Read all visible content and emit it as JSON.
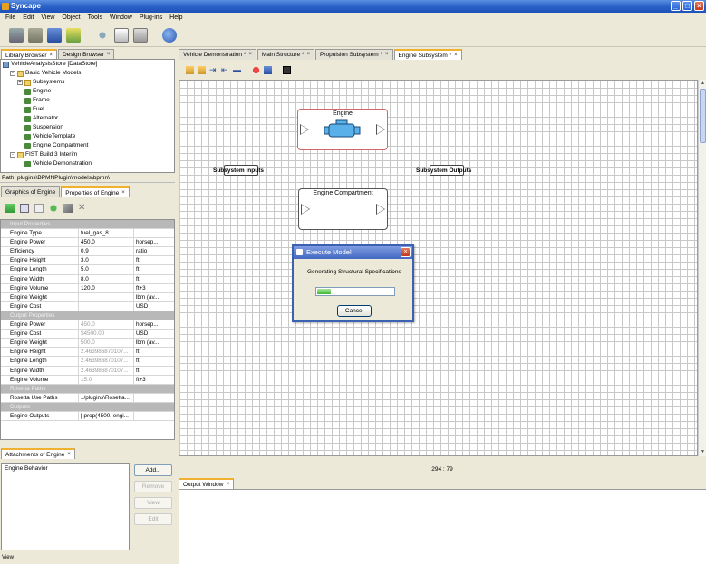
{
  "window": {
    "title": "Syncape"
  },
  "menu": [
    "File",
    "Edit",
    "View",
    "Object",
    "Tools",
    "Window",
    "Plug-ins",
    "Help"
  ],
  "toolbar": {
    "icons": [
      "print-icon",
      "package-icon",
      "save-icon",
      "open-folder-icon",
      "cut-icon",
      "copy-icon",
      "paste-icon",
      "help-icon"
    ]
  },
  "left_tabs": [
    {
      "label": "Library Browser",
      "active": true
    },
    {
      "label": "Design Browser",
      "active": false
    }
  ],
  "library_tree": [
    {
      "label": "VehicleAnalysisStore [DataStore]",
      "indent": 0,
      "icon": "store"
    },
    {
      "label": "Basic Vehicle Models",
      "indent": 1,
      "icon": "folder",
      "expander": "-"
    },
    {
      "label": "Subsystems",
      "indent": 2,
      "icon": "folder",
      "expander": "+"
    },
    {
      "label": "Engine",
      "indent": 3,
      "icon": "model"
    },
    {
      "label": "Frame",
      "indent": 3,
      "icon": "model"
    },
    {
      "label": "Fuel",
      "indent": 3,
      "icon": "model"
    },
    {
      "label": "Alternator",
      "indent": 3,
      "icon": "model"
    },
    {
      "label": "Suspension",
      "indent": 3,
      "icon": "model"
    },
    {
      "label": "VehicleTemplate",
      "indent": 3,
      "icon": "model"
    },
    {
      "label": "Engine Compartment",
      "indent": 3,
      "icon": "model"
    },
    {
      "label": "FIST Build 3 Interim",
      "indent": 1,
      "icon": "folder",
      "expander": "-"
    },
    {
      "label": "Vehicle Demonstration",
      "indent": 3,
      "icon": "model"
    }
  ],
  "path_bar": "Path: plugins\\BPMNPlugin\\models\\bpmn\\",
  "prop_tabs": [
    {
      "label": "Graphics of Engine",
      "active": false
    },
    {
      "label": "Properties of Engine",
      "active": true
    }
  ],
  "properties": {
    "input_header": "Input Properties",
    "input_rows": [
      [
        "Engine Type",
        "fuel_gas_8",
        ""
      ],
      [
        "Engine Power",
        "450.0",
        "horsep..."
      ],
      [
        "Efficiency",
        "0.9",
        "ratio"
      ],
      [
        "Engine Height",
        "3.0",
        "ft"
      ],
      [
        "Engine Length",
        "5.0",
        "ft"
      ],
      [
        "Engine Width",
        "8.0",
        "ft"
      ],
      [
        "Engine Volume",
        "120.0",
        "ft+3"
      ],
      [
        "Engine Weight",
        "",
        "lbm (av..."
      ],
      [
        "Engine Cost",
        "",
        "USD"
      ]
    ],
    "output_header": "Output Properties",
    "output_rows": [
      [
        "Engine Power",
        "450.0",
        "horsep..."
      ],
      [
        "Engine Cost",
        "$4500.00",
        "USD"
      ],
      [
        "Engine Weight",
        "500.0",
        "lbm (av..."
      ],
      [
        "Engine Height",
        "2.463986870107...",
        "ft"
      ],
      [
        "Engine Length",
        "2.463986870107...",
        "ft"
      ],
      [
        "Engine Width",
        "2.463986870107...",
        "ft"
      ],
      [
        "Engine Volume",
        "15.0",
        "ft+3"
      ]
    ],
    "rosetta_header": "Rosetta Paths",
    "rosetta_rows": [
      [
        "Rosetta Use Paths",
        "../plugins\\Rosetta...",
        ""
      ]
    ],
    "outputs_header": "Outputs",
    "outputs_rows": [
      [
        "Engine Outputs",
        "[ prop(4500, engi...",
        ""
      ]
    ]
  },
  "attachments": {
    "tab_label": "Attachments of Engine",
    "list_items": [
      "Engine Behavior"
    ],
    "buttons": {
      "add": "Add...",
      "remove": "Remove",
      "view": "View",
      "edit": "Edit"
    },
    "view_label": "View"
  },
  "editor_tabs": [
    {
      "label": "Vehicle Demonstration *",
      "active": false
    },
    {
      "label": "Main Structure *",
      "active": false
    },
    {
      "label": "Propulsion Subsystem *",
      "active": false
    },
    {
      "label": "Engine Subsystem *",
      "active": true
    }
  ],
  "diagram": {
    "engine_block": "Engine",
    "compartment_block": "Engine Compartment",
    "subsystem_inputs": "Subsystem Inputs",
    "subsystem_outputs": "Subsystem Outputs"
  },
  "status_coords": "294 : 79",
  "output_tab": "Output Window",
  "dialog": {
    "title": "Execute Model",
    "message": "Generating Structural Specifications",
    "progress": 0.18,
    "cancel": "Cancel"
  },
  "colors": {
    "title_bar": "#2a62c9",
    "active_tab_accent": "#f0b030",
    "engine_highlight": "#e07070",
    "engine_icon": "#5ab0e8",
    "progress_green": "#3fb733"
  }
}
